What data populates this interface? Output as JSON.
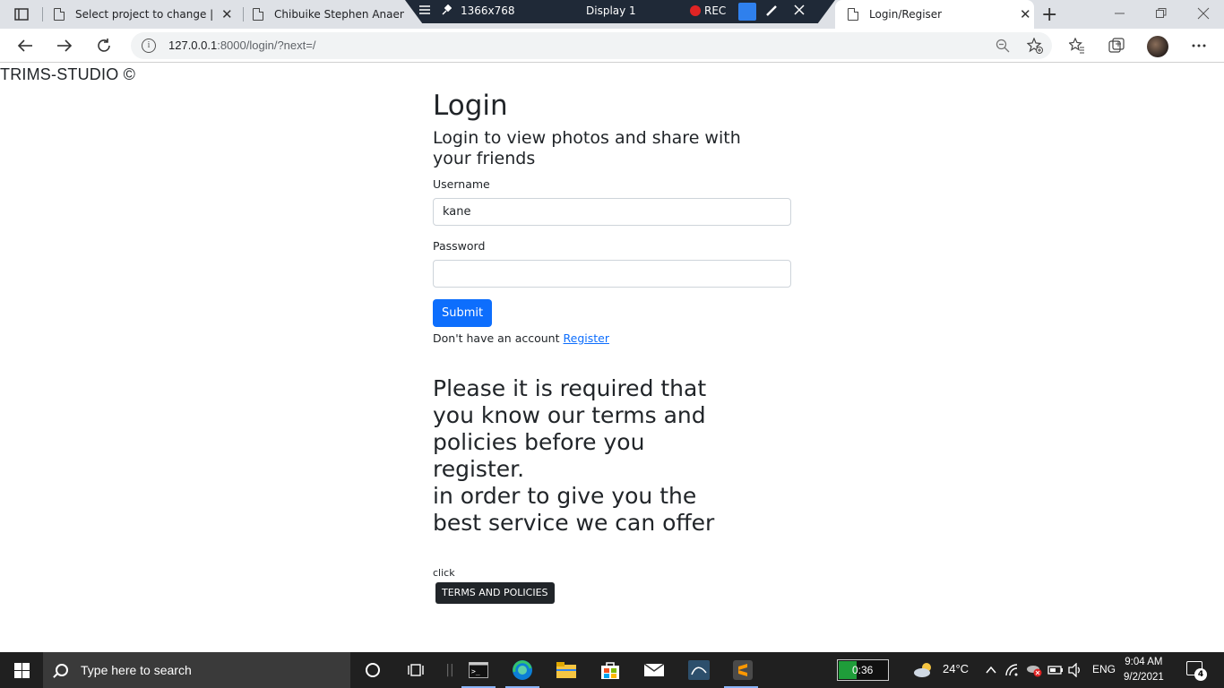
{
  "browser": {
    "tabs": [
      {
        "title": "Select project to change | Dja",
        "close": "✕"
      },
      {
        "title": "Chibuike Stephen Anaenug"
      },
      {
        "title": "Login/Regiser",
        "close": "✕",
        "active": true
      }
    ],
    "new_tab": "+",
    "recorder": {
      "resolution": "1366x768",
      "display": "Display 1",
      "rec_label": "REC"
    },
    "url_host": "127.0.0.1",
    "url_rest": ":8000/login/?next=/"
  },
  "page": {
    "brand": "TRIMS-STUDIO ©",
    "title": "Login",
    "subtitle": "Login to view photos and share with your friends",
    "username_label": "Username",
    "username_value": "kane",
    "password_label": "Password",
    "password_value": "",
    "submit_label": "Submit",
    "no_account_text": "Don't have an account",
    "register_link": "Register",
    "notice_line1": "Please it is required that you know our terms and policies before you register.",
    "notice_line2": "in order to give you the best service we can offer",
    "click_label": "click",
    "terms_button": "TERMS AND POLICIES"
  },
  "taskbar": {
    "search_placeholder": "Type here to search",
    "timer": "0:36",
    "temperature": "24°C",
    "language": "ENG",
    "time": "9:04 AM",
    "date": "9/2/2021",
    "notification_count": "4"
  },
  "colors": {
    "primary": "#0d6efd",
    "dark": "#212529",
    "rec_red": "#e02424",
    "taskbar": "#202020"
  }
}
